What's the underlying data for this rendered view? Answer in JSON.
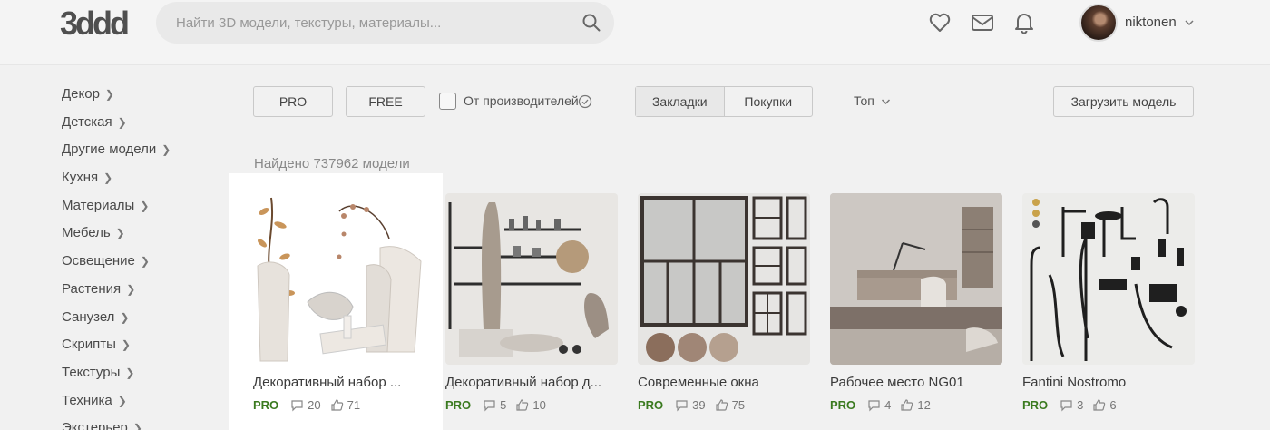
{
  "header": {
    "logo_text": "3ddd",
    "search_placeholder": "Найти 3D модели, текстуры, материалы...",
    "username": "niktonen"
  },
  "sidebar": {
    "items": [
      {
        "label": "Декор"
      },
      {
        "label": "Детская"
      },
      {
        "label": "Другие модели"
      },
      {
        "label": "Кухня"
      },
      {
        "label": "Материалы"
      },
      {
        "label": "Мебель"
      },
      {
        "label": "Освещение"
      },
      {
        "label": "Растения"
      },
      {
        "label": "Санузел"
      },
      {
        "label": "Скрипты"
      },
      {
        "label": "Текстуры"
      },
      {
        "label": "Техника"
      },
      {
        "label": "Экстерьер"
      }
    ]
  },
  "filters": {
    "pro_label": "PRO",
    "free_label": "FREE",
    "manufacturers_label": "От производителей",
    "bookmarks_label": "Закладки",
    "purchases_label": "Покупки",
    "sort_label": "Топ",
    "upload_label": "Загрузить модель"
  },
  "results": {
    "found_text": "Найдено 737962 модели"
  },
  "cards": [
    {
      "title": "Декоративный набор ...",
      "badge": "PRO",
      "comments": "20",
      "likes": "71"
    },
    {
      "title": "Декоративный набор д...",
      "badge": "PRO",
      "comments": "5",
      "likes": "10"
    },
    {
      "title": "Современные окна",
      "badge": "PRO",
      "comments": "39",
      "likes": "75"
    },
    {
      "title": "Рабочее место NG01",
      "badge": "PRO",
      "comments": "4",
      "likes": "12"
    },
    {
      "title": "Fantini Nostromo",
      "badge": "PRO",
      "comments": "3",
      "likes": "6"
    }
  ],
  "colors": {
    "pro_green": "#3a7a1f",
    "background": "#f1f1f1"
  }
}
